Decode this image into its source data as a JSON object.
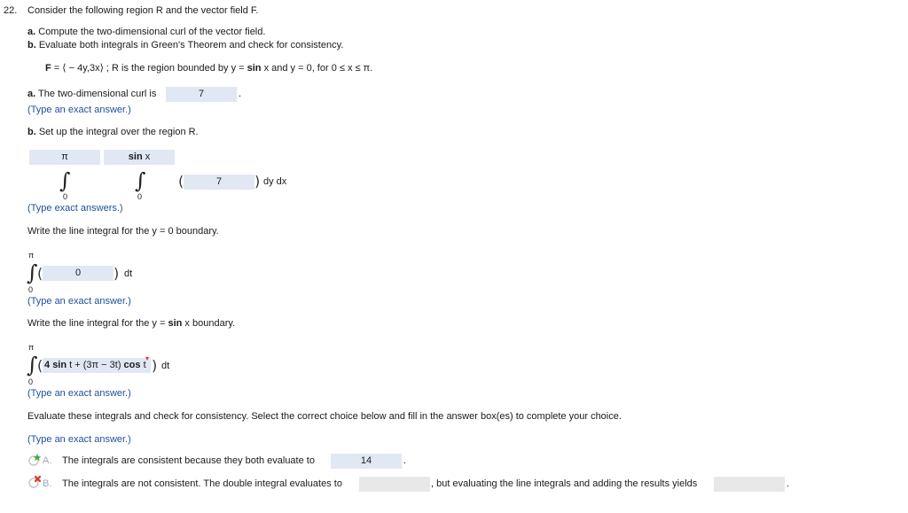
{
  "problem": {
    "number": "22.",
    "intro": "Consider the following region R and the vector field F.",
    "part_a_label": "a.",
    "part_a_text": " Compute the two-dimensional curl of the vector field.",
    "part_b_label": "b.",
    "part_b_text": " Evaluate both integrals in Green's Theorem and check for consistency.",
    "field_F": "F",
    "field_rest_1": " = ⟨ − 4y,3x⟩ ; R is the region bounded by y = ",
    "field_sin": "sin",
    "field_rest_2": " x and y = 0, for 0 ≤ x ≤ π."
  },
  "section_a": {
    "prompt_label": "a.",
    "prompt_text": " The two-dimensional curl is",
    "answer": "7",
    "period": ".",
    "hint": "(Type an exact answer.)"
  },
  "section_b": {
    "prompt_label": "b.",
    "prompt_text": " Set up the integral over the region R.",
    "outer_upper": "π",
    "outer_lower": "0",
    "inner_upper_bold": "sin",
    "inner_upper_rest": " x",
    "inner_lower": "0",
    "integrand": "7",
    "differentials": "dy dx",
    "hint": "(Type exact answers.)"
  },
  "line_y0": {
    "prompt": "Write the line integral for the y = 0 boundary.",
    "upper": "π",
    "lower": "0",
    "integrand": "0",
    "dt": "dt",
    "hint": "(Type an exact answer.)"
  },
  "line_sinx": {
    "prompt_start": "Write the line integral for the y = ",
    "prompt_bold": "sin",
    "prompt_end": " x boundary.",
    "upper": "π",
    "lower": "0",
    "expr_4": "4 ",
    "expr_sin": "sin",
    "expr_mid": " t + (3π − 3t) ",
    "expr_cos": "cos",
    "expr_t": " t",
    "dt": "dt",
    "hint": "(Type an exact answer.)"
  },
  "evaluate": {
    "prompt": "Evaluate these integrals and check for consistency. Select the correct choice below and fill in the answer box(es) to complete your choice.",
    "hint": "(Type an exact answer.)"
  },
  "choices": [
    {
      "letter": "A.",
      "text": "The integrals are consistent because they both evaluate to",
      "answer": "14",
      "suffix": ".",
      "icon": "correct-star-icon",
      "icon_color": "#3fae49"
    },
    {
      "letter": "B.",
      "text": "The integrals are not consistent. The double integral evaluates to",
      "answer": "",
      "mid_text": ", but evaluating the line integrals and adding the results yields",
      "answer2": "",
      "suffix": ".",
      "icon": "incorrect-x-icon",
      "icon_color": "#d9342b"
    }
  ],
  "colors": {
    "answer_box": "#e1e8f3",
    "empty_box": "#e8e8e8",
    "hint_text": "#1f4f9c"
  }
}
